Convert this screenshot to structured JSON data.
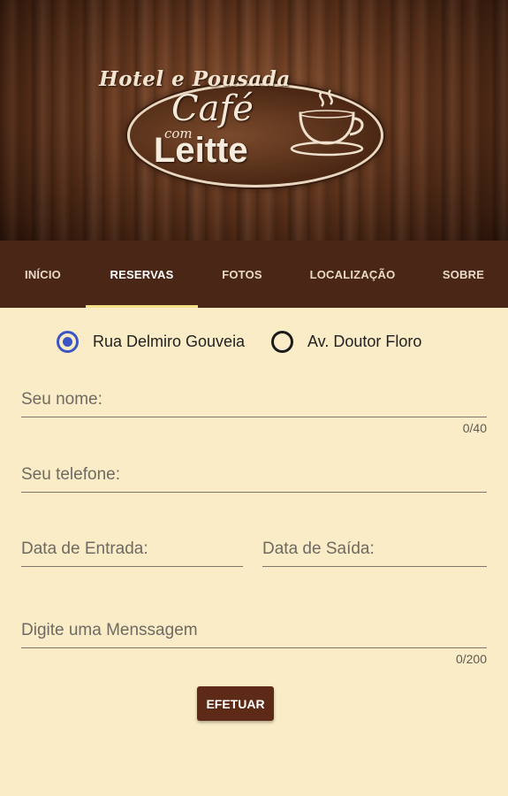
{
  "header": {
    "logo_top": "Hotel e Pousada",
    "logo_cafe": "Café",
    "logo_com": "com",
    "logo_leitte": "Leitte",
    "logo_icon": "coffee-cup-icon"
  },
  "tabs": [
    {
      "label": "INÍCIO",
      "active": false
    },
    {
      "label": "RESERVAS",
      "active": true
    },
    {
      "label": "FOTOS",
      "active": false
    },
    {
      "label": "LOCALIZAÇÃO",
      "active": false
    },
    {
      "label": "SOBRE",
      "active": false
    }
  ],
  "locations": [
    {
      "label": "Rua Delmiro Gouveia",
      "selected": true
    },
    {
      "label": "Av. Doutor Floro",
      "selected": false
    }
  ],
  "form": {
    "name_label": "Seu nome:",
    "name_counter": "0/40",
    "phone_label": "Seu telefone:",
    "checkin_label": "Data de Entrada:",
    "checkout_label": "Data de Saída:",
    "message_label": "Digite uma Menssagem",
    "message_counter": "0/200",
    "submit_label": "EFETUAR"
  },
  "colors": {
    "tabbar": "#4a2617",
    "tab_indicator": "#f6e08a",
    "background": "#f9ecc6",
    "radio_accent": "#3d55c4",
    "button": "#5c2a16"
  }
}
